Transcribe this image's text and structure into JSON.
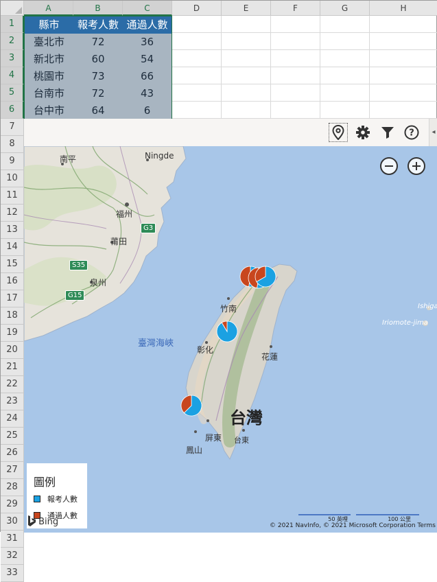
{
  "sheet": {
    "columns": [
      "A",
      "B",
      "C",
      "D",
      "E",
      "F",
      "G",
      "H"
    ],
    "rows": [
      "1",
      "2",
      "3",
      "4",
      "5",
      "6",
      "7",
      "8",
      "9",
      "10",
      "11",
      "12",
      "13",
      "14",
      "15",
      "16",
      "17",
      "18",
      "19",
      "20",
      "21",
      "22",
      "23",
      "24",
      "25",
      "26",
      "27",
      "28",
      "29",
      "30",
      "31",
      "32",
      "33"
    ]
  },
  "table": {
    "headers": [
      "縣市",
      "報考人數",
      "通過人數"
    ],
    "rows": [
      [
        "臺北市",
        "72",
        "36"
      ],
      [
        "新北市",
        "60",
        "54"
      ],
      [
        "桃園市",
        "73",
        "66"
      ],
      [
        "台南市",
        "72",
        "43"
      ],
      [
        "台中市",
        "64",
        "6"
      ]
    ]
  },
  "map": {
    "toolbar": {
      "pin_icon": "map-pin-icon",
      "settings_icon": "gear-icon",
      "filter_icon": "filter-icon",
      "help_icon": "help-icon",
      "collapse_icon": "chevron-left-icon"
    },
    "labels": {
      "nanping": "南平",
      "ningde": "Ningde",
      "fuzhou": "福州",
      "putian": "莆田",
      "quanzhou": "泉州",
      "strait": "臺灣海峽",
      "zhunan": "竹南",
      "changhua": "彰化",
      "hualien": "花蓮",
      "taiwan": "台灣",
      "pingtung": "屏東",
      "taitung": "台東",
      "fengshan": "鳳山",
      "ishigaki": "Ishigaki",
      "iriomote": "Iriomote-jima"
    },
    "road_shields": [
      "G3",
      "S35",
      "G15"
    ],
    "legend": {
      "title": "圖例",
      "items": [
        {
          "label": "報考人數",
          "color": "#1ba1e2"
        },
        {
          "label": "通過人數",
          "color": "#c8461e"
        }
      ]
    },
    "bing": "Bing",
    "copyright": "© 2021 NavInfo, © 2021 Microsoft Corporation  Terms",
    "scale": [
      "50 英哩",
      "100 公里"
    ]
  },
  "chart_data": {
    "type": "pie",
    "title": "",
    "series": [
      {
        "name": "報考人數",
        "color": "#1ba1e2"
      },
      {
        "name": "通過人數",
        "color": "#c8461e"
      }
    ],
    "locations": [
      {
        "name": "臺北市",
        "報考人數": 72,
        "通過人數": 36
      },
      {
        "name": "新北市",
        "報考人數": 60,
        "通過人數": 54
      },
      {
        "name": "桃園市",
        "報考人數": 73,
        "通過人數": 66
      },
      {
        "name": "台南市",
        "報考人數": 72,
        "通過人數": 43
      },
      {
        "name": "台中市",
        "報考人數": 64,
        "通過人數": 6
      }
    ]
  }
}
